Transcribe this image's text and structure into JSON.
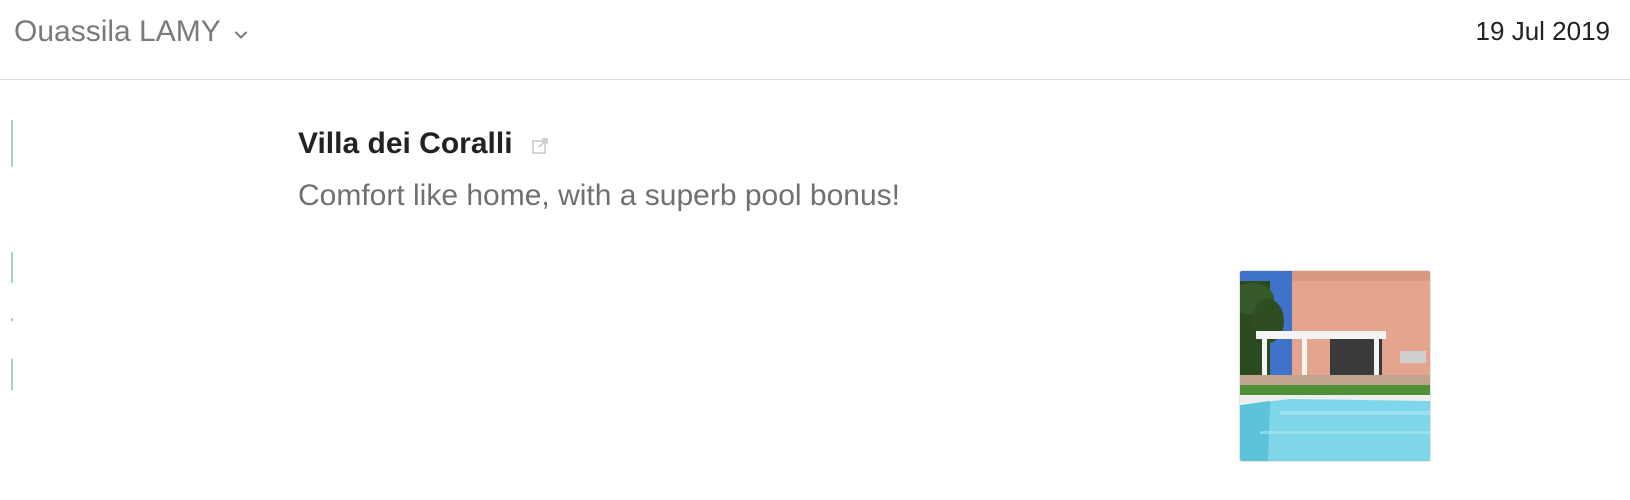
{
  "header": {
    "sender_name": "Ouassila LAMY",
    "date": "19 Jul 2019"
  },
  "card": {
    "title": "Villa dei Coralli",
    "description": "Comfort like home, with a superb pool bonus!"
  },
  "icons": {
    "sender_dropdown": "chevron-down-icon",
    "external_link": "external-link-icon"
  },
  "colors": {
    "quote_bar": "#9fd8b6",
    "header_text": "#7a7a7a",
    "title_text": "#222222",
    "description_text": "#707070"
  }
}
